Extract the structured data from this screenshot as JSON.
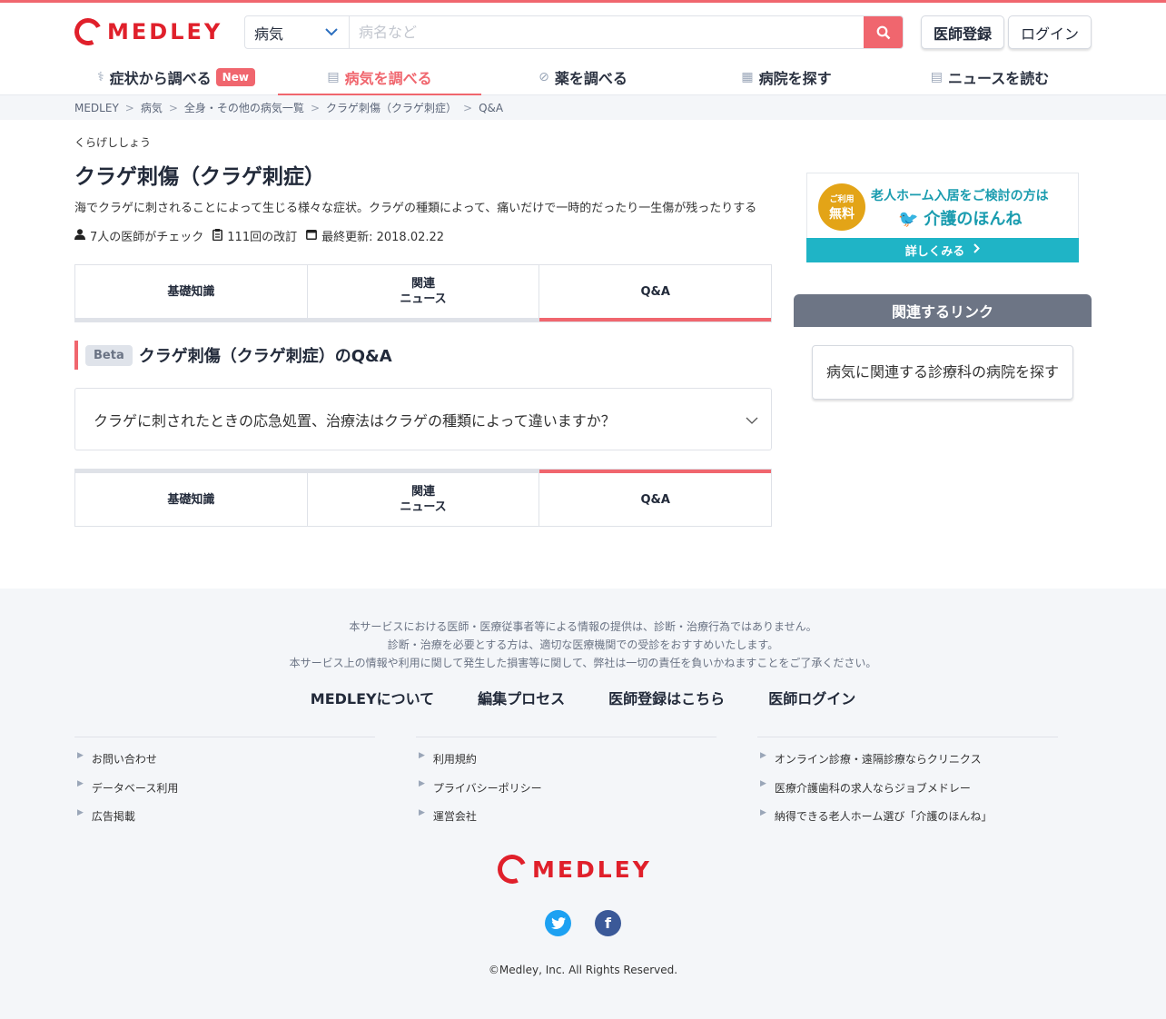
{
  "brand": {
    "name": "MEDLEY",
    "color": "#e0202b",
    "accent": "#f0666e"
  },
  "header": {
    "search_category": "病気",
    "search_placeholder": "病名など",
    "register_label": "医師登録",
    "login_label": "ログイン"
  },
  "nav": [
    {
      "label": "症状から調べる",
      "icon": "stethoscope-icon",
      "badge": "New"
    },
    {
      "label": "病気を調べる",
      "icon": "clipboard-icon"
    },
    {
      "label": "薬を調べる",
      "icon": "pill-icon"
    },
    {
      "label": "病院を探す",
      "icon": "hospital-icon"
    },
    {
      "label": "ニュースを読む",
      "icon": "newspaper-icon"
    }
  ],
  "breadcrumb": [
    "MEDLEY",
    "病気",
    "全身・その他の病気一覧",
    "クラゲ刺傷（クラゲ刺症）",
    "Q&A"
  ],
  "article": {
    "ruby": "くらげししょう",
    "title": "クラゲ刺傷（クラゲ刺症）",
    "description": "海でクラゲに刺されることによって生じる様々な症状。クラゲの種類によって、痛いだけで一時的だったり一生傷が残ったりする",
    "doctors": "7人の医師がチェック",
    "revisions": "111回の改訂",
    "updated": "最終更新: 2018.02.22"
  },
  "tabs": [
    {
      "label": "基礎知識"
    },
    {
      "label": "関連\nニュース"
    },
    {
      "label": "Q&A"
    }
  ],
  "qa": {
    "beta": "Beta",
    "heading": "クラゲ刺傷（クラゲ刺症）のQ&A",
    "items": [
      "クラゲに刺されたときの応急処置、治療法はクラゲの種類によって違いますか？"
    ]
  },
  "ad": {
    "circle_small": "ご利用",
    "circle_big": "無料",
    "line1": "老人ホーム入居をご検討の方は",
    "line2": "介護のほんね",
    "cta": "詳しくみる"
  },
  "related": {
    "heading": "関連するリンク",
    "button": "病気に関連する診療科の病院を探す"
  },
  "footer": {
    "disclaimer": [
      "本サービスにおける医師・医療従事者等による情報の提供は、診断・治療行為ではありません。",
      "診断・治療を必要とする方は、適切な医療機関での受診をおすすめいたします。",
      "本サービス上の情報や利用に関して発生した損害等に関して、弊社は一切の責任を負いかねますことをご了承ください。"
    ],
    "main_links": [
      "MEDLEYについて",
      "編集プロセス",
      "医師登録はこちら",
      "医師ログイン"
    ],
    "columns": [
      [
        "お問い合わせ",
        "データベース利用",
        "広告掲載"
      ],
      [
        "利用規約",
        "プライバシーポリシー",
        "運営会社"
      ],
      [
        "オンライン診療・遠隔診療ならクリニクス",
        "医療介護歯科の求人ならジョブメドレー",
        "納得できる老人ホーム選び「介護のほんね」"
      ]
    ],
    "copyright": "©Medley, Inc. All Rights Reserved."
  }
}
